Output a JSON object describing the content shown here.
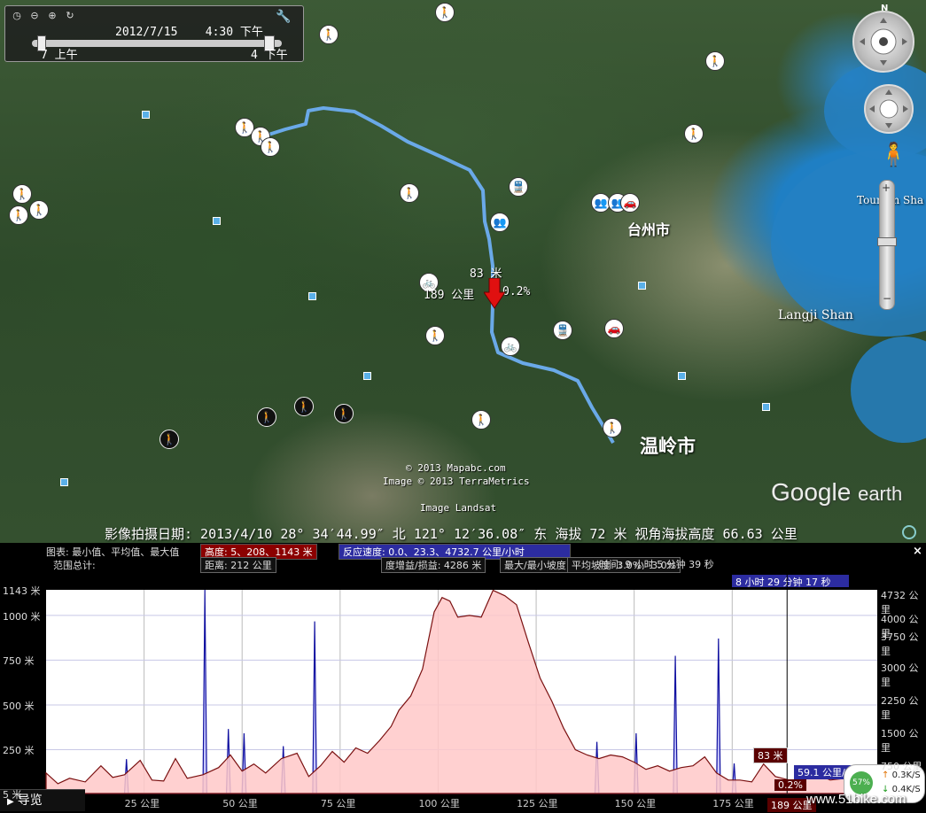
{
  "time_slider": {
    "date": "2012/7/15",
    "time": "4:30 下午",
    "start_label": "7 上午",
    "end_label": "4 下午"
  },
  "nav": {
    "north": "N"
  },
  "map_labels": {
    "city1": "台州市",
    "city2": "温岭市",
    "island1": "Langji Shan",
    "island2": "Toumen Sha"
  },
  "marker": {
    "elevation": "83 米",
    "distance": "189 公里",
    "grade": "0.2%"
  },
  "attribution": {
    "line1": "© 2013 Mapabc.com",
    "line2": "Image © 2013 TerraMetrics",
    "line3": "Image Landsat"
  },
  "logo": {
    "google": "Google",
    "earth": "earth"
  },
  "status_bar": {
    "text": "影像拍摄日期: 2013/4/10   28° 34′44.99″ 北 121° 12′36.08″ 东 海拔      72 米   视角海拔高度   66.63 公里"
  },
  "profile": {
    "close": "×",
    "stats_label": "图表: 最小值、平均值、最大值",
    "elev_stats": "高度: 5、208、1143 米",
    "speed_stats": "反应速度: 0.0、23.3、4732.7 公里/小时",
    "range_label": "范围总计:",
    "distance": "距离: 212 公里",
    "gain": "度增益/损益: 4286 米",
    "max_up": "最大/最小坡度: 27.8% / -4.8%",
    "max_down": "平均坡度: 3.0%, -3.0%",
    "time": "时间: 9 小时 5 分钟 39 秒",
    "selection_time": "8 小时 29 分钟 17 秒"
  },
  "chart_data": {
    "type": "area",
    "x_unit": "公里",
    "x_ticks": [
      "25 公里",
      "50 公里",
      "75 公里",
      "100 公里",
      "125 公里",
      "150 公里",
      "175 公里",
      "189 公里"
    ],
    "y_left_ticks": [
      "1143 米",
      "1000 米",
      "750 米",
      "500 米",
      "250 米",
      "5 米"
    ],
    "y_right_ticks": [
      "4732 公里",
      "4000 公里",
      "3750 公里",
      "3000 公里",
      "2250 公里",
      "1500 公里",
      "750 公里"
    ],
    "xlim": [
      0,
      212
    ],
    "ylim_left": [
      5,
      1143
    ],
    "series": [
      {
        "name": "高度",
        "color": "#ffc8c8",
        "x": [
          0,
          3,
          6,
          10,
          14,
          17,
          20,
          24,
          27,
          30,
          33,
          36,
          40,
          44,
          47,
          50,
          53,
          56,
          60,
          64,
          67,
          70,
          73,
          76,
          79,
          82,
          85,
          88,
          90,
          93,
          96,
          99,
          101,
          103,
          105,
          108,
          111,
          114,
          117,
          120,
          123,
          126,
          129,
          132,
          135,
          138,
          141,
          144,
          147,
          150,
          153,
          156,
          159,
          162,
          165,
          168,
          171,
          174,
          177,
          180,
          183,
          186,
          189,
          192,
          196,
          200,
          204,
          208,
          212
        ],
        "values": [
          120,
          60,
          90,
          70,
          160,
          95,
          110,
          190,
          80,
          75,
          200,
          90,
          110,
          150,
          220,
          130,
          170,
          120,
          200,
          230,
          100,
          160,
          240,
          180,
          260,
          230,
          300,
          380,
          470,
          550,
          700,
          1020,
          1100,
          1080,
          990,
          1000,
          990,
          1140,
          1110,
          1060,
          850,
          650,
          520,
          370,
          250,
          220,
          200,
          220,
          210,
          180,
          140,
          160,
          130,
          150,
          160,
          210,
          120,
          80,
          80,
          70,
          170,
          100,
          83,
          60,
          120,
          80,
          90,
          60,
          150
        ]
      },
      {
        "name": "反应速度",
        "color": "#c8c8ff",
        "x": [
          0,
          20,
          20.5,
          21,
          40,
          40.5,
          41,
          46,
          46.5,
          47,
          50,
          50.5,
          51,
          60,
          60.5,
          61,
          68,
          68.5,
          69,
          80,
          140,
          140.5,
          141,
          150,
          150.5,
          151,
          160,
          160.5,
          161,
          171,
          171.5,
          172,
          175,
          175.5,
          176,
          190,
          212
        ],
        "values": [
          0,
          0,
          800,
          0,
          0,
          4732,
          0,
          0,
          1500,
          0,
          0,
          1400,
          0,
          0,
          1100,
          0,
          0,
          4000,
          0,
          0,
          0,
          1200,
          0,
          0,
          1400,
          0,
          0,
          3200,
          0,
          0,
          3600,
          0,
          0,
          700,
          0,
          0,
          0
        ]
      }
    ]
  },
  "cursor": {
    "elevation": "83 米",
    "speed": "59.1 公里/小时",
    "grade": "0.2%",
    "distance": "189 公里"
  },
  "bottom_nav": {
    "label": "导览"
  },
  "net": {
    "pct": "57%",
    "up": "0.3K/S",
    "down": "0.4K/S"
  },
  "watermark": "www.51bike.com"
}
